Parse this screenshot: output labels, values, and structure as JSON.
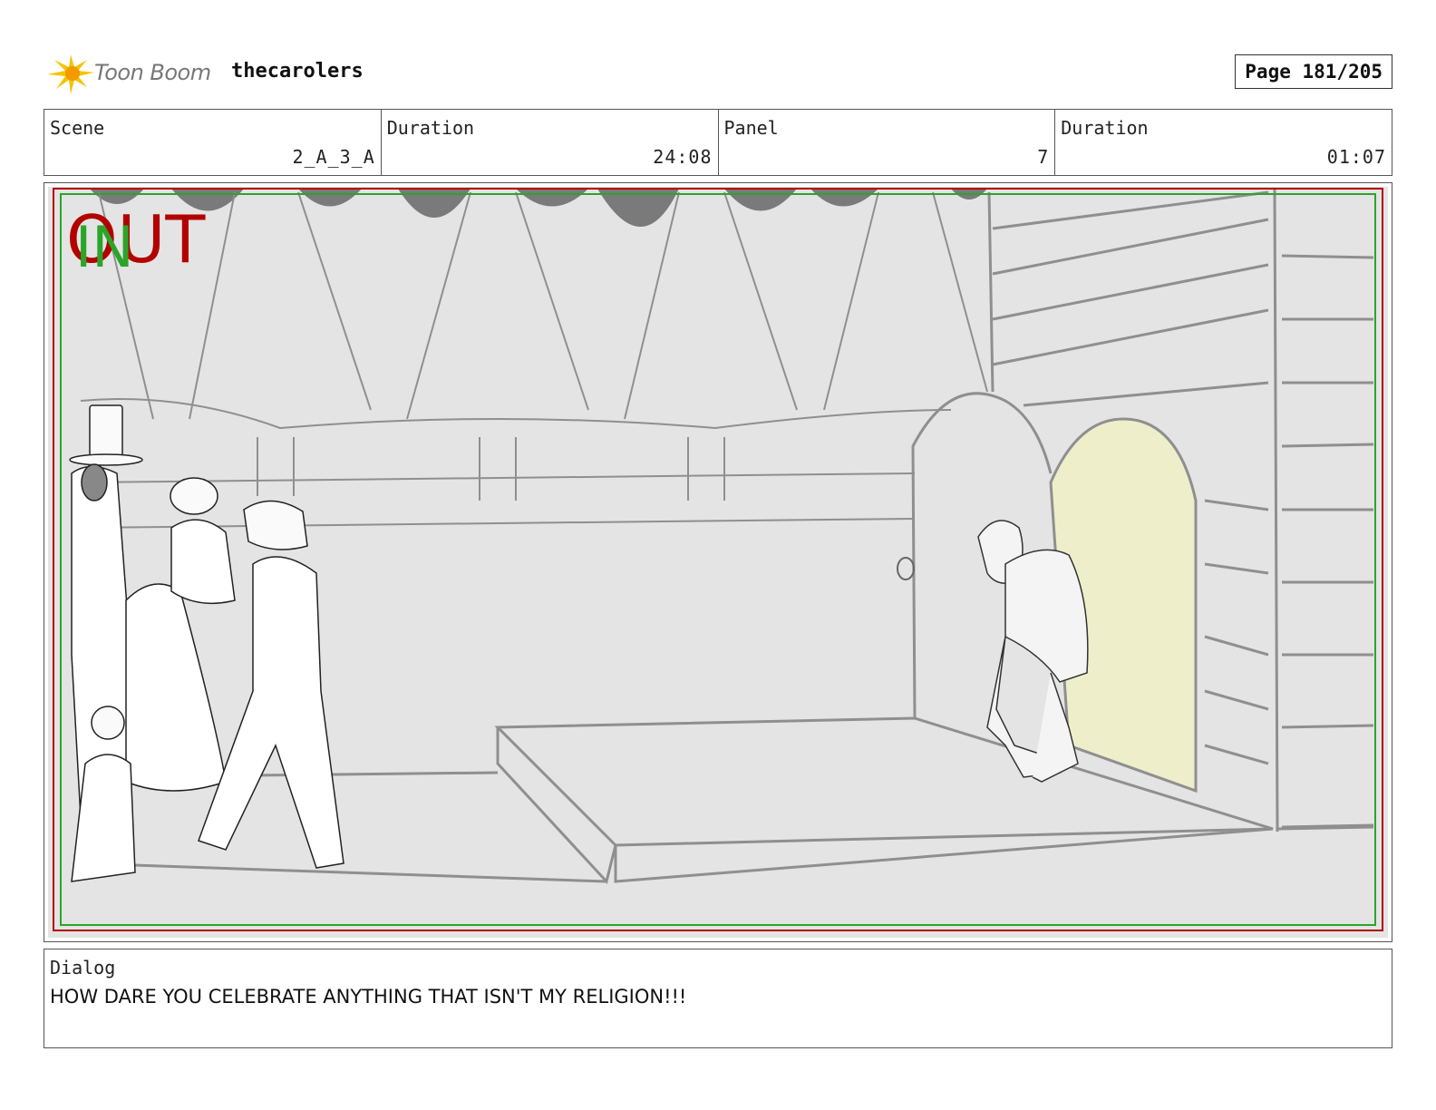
{
  "header": {
    "logo_text": "Toon Boom",
    "project_name": "thecarolers",
    "page_label": "Page 181/205"
  },
  "info": {
    "scene_label": "Scene",
    "scene_value": "2_A_3_A",
    "duration_label": "Duration",
    "duration_value": "24:08",
    "panel_label": "Panel",
    "panel_value": "7",
    "panel_duration_label": "Duration",
    "panel_duration_value": "01:07"
  },
  "frame": {
    "out_marker": "OUT",
    "in_marker": "IN",
    "colors": {
      "out": "#b30000",
      "in": "#2aa52a",
      "doorway": "#eeeecb",
      "background": "#e4e4e4",
      "drape": "#7a7a7a"
    }
  },
  "dialog": {
    "label": "Dialog",
    "text": "HOW DARE YOU CELEBRATE ANYTHING THAT ISN'T MY RELIGION!!!"
  }
}
